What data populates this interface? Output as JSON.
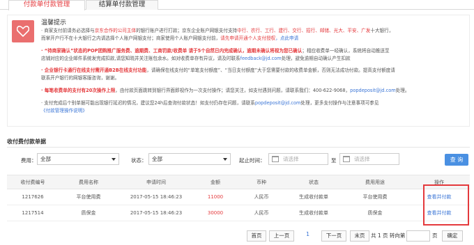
{
  "tabs": [
    "付款单付款管理",
    "结算单付款管理"
  ],
  "notice": {
    "title": "温馨提示",
    "l1a": "· 商家支付前请务必选择与",
    "l1b": "京东合作的公司主体",
    "l1c": "的银行账户进行打款；京东企业账户网银支付支持",
    "l1d": "中行、农行、工行、建行、交行、招行、邮储、光大、平安、广发",
    "l1e": "十大银行，",
    "l2a": "而掌开户行不在十大银行之内请选择个人账户网银支付；商家使用个人账户网银支付前，",
    "l2b": "请先申请开通个人支付授权",
    "l2c": "，点此申请",
    "l3a": "· “待商家确认”状态的POP团购推广服务费、逾期费、工商罚款/收费单 请于5个自然日内完成确认，逾期未确认将视为您已确认",
    "l3b": "；相应收费单一经确认，系统将自动推送至",
    "l4": "店铺对应的企业邮件系统发完成扣款,请您知晓并关注账包余水。如对收费单存有异议，请及时联系",
    "l4b": "feedback@jd.com",
    "l4c": "处理，避免逾期自动确认产生扣款",
    "l5a": "· 企业银行卡通行在线支付需开通B2B在线支付功能",
    "l5b": "，请确保在线支付的“单笔支付额度”、“当日支付额度”大于您需要付款的收费单金额，否则无法成功付款。提高支付额度请",
    "l6": "联系开户银行的网银客服咨询，谢谢。",
    "l7a": "· 每笔收费单的支付有20次操作上限",
    "l7b": "，由付款页面跳转到银行界面即视作为一次支付操作；请您关注，如支付遇到问题，请联系我们：400-622-9068，",
    "l7c": "popdeposit@jd.com",
    "l7d": "处理。",
    "l8a": "· 支付完成后个别单据可能出现银行延迟的情况，建议您24h后查询付款状态！如支付仍存在问题，请联系",
    "l8b": "popdeposit@jd.com",
    "l8c": "处理，更多支付操作与注意事项可参见",
    "l9": "《付款管理操作说明》"
  },
  "section_title": "收付费付款单据",
  "filters": {
    "fee_label": "费用：",
    "fee_value": "全部",
    "status_label": "状态：",
    "status_value": "全部",
    "time_label": "起止时间：",
    "start_placeholder": "请选择",
    "to_label": "至",
    "end_placeholder": "请选择",
    "search": "查 询"
  },
  "table": {
    "headers": [
      "收付费编号",
      "费用名称",
      "申请时间",
      "金额",
      "币种",
      "状态",
      "费用用途",
      "操作"
    ],
    "rows": [
      [
        "1217626",
        "平台使用费",
        "2017-05-15 18:46:23",
        "11000",
        "人民币",
        "生成收付款单",
        "平台使用费",
        "查看并付款"
      ],
      [
        "1217514",
        "质保金",
        "2017-05-15 18:46:23",
        "30000",
        "人民币",
        "生成收付款单",
        "质保金",
        "查看并付款"
      ]
    ]
  },
  "pager": {
    "first": "首页",
    "prev": "上一页",
    "current": "1",
    "next": "下一页",
    "last": "末页",
    "total": "共 1 页 转向第",
    "page_unit": "页",
    "confirm": "确定"
  }
}
